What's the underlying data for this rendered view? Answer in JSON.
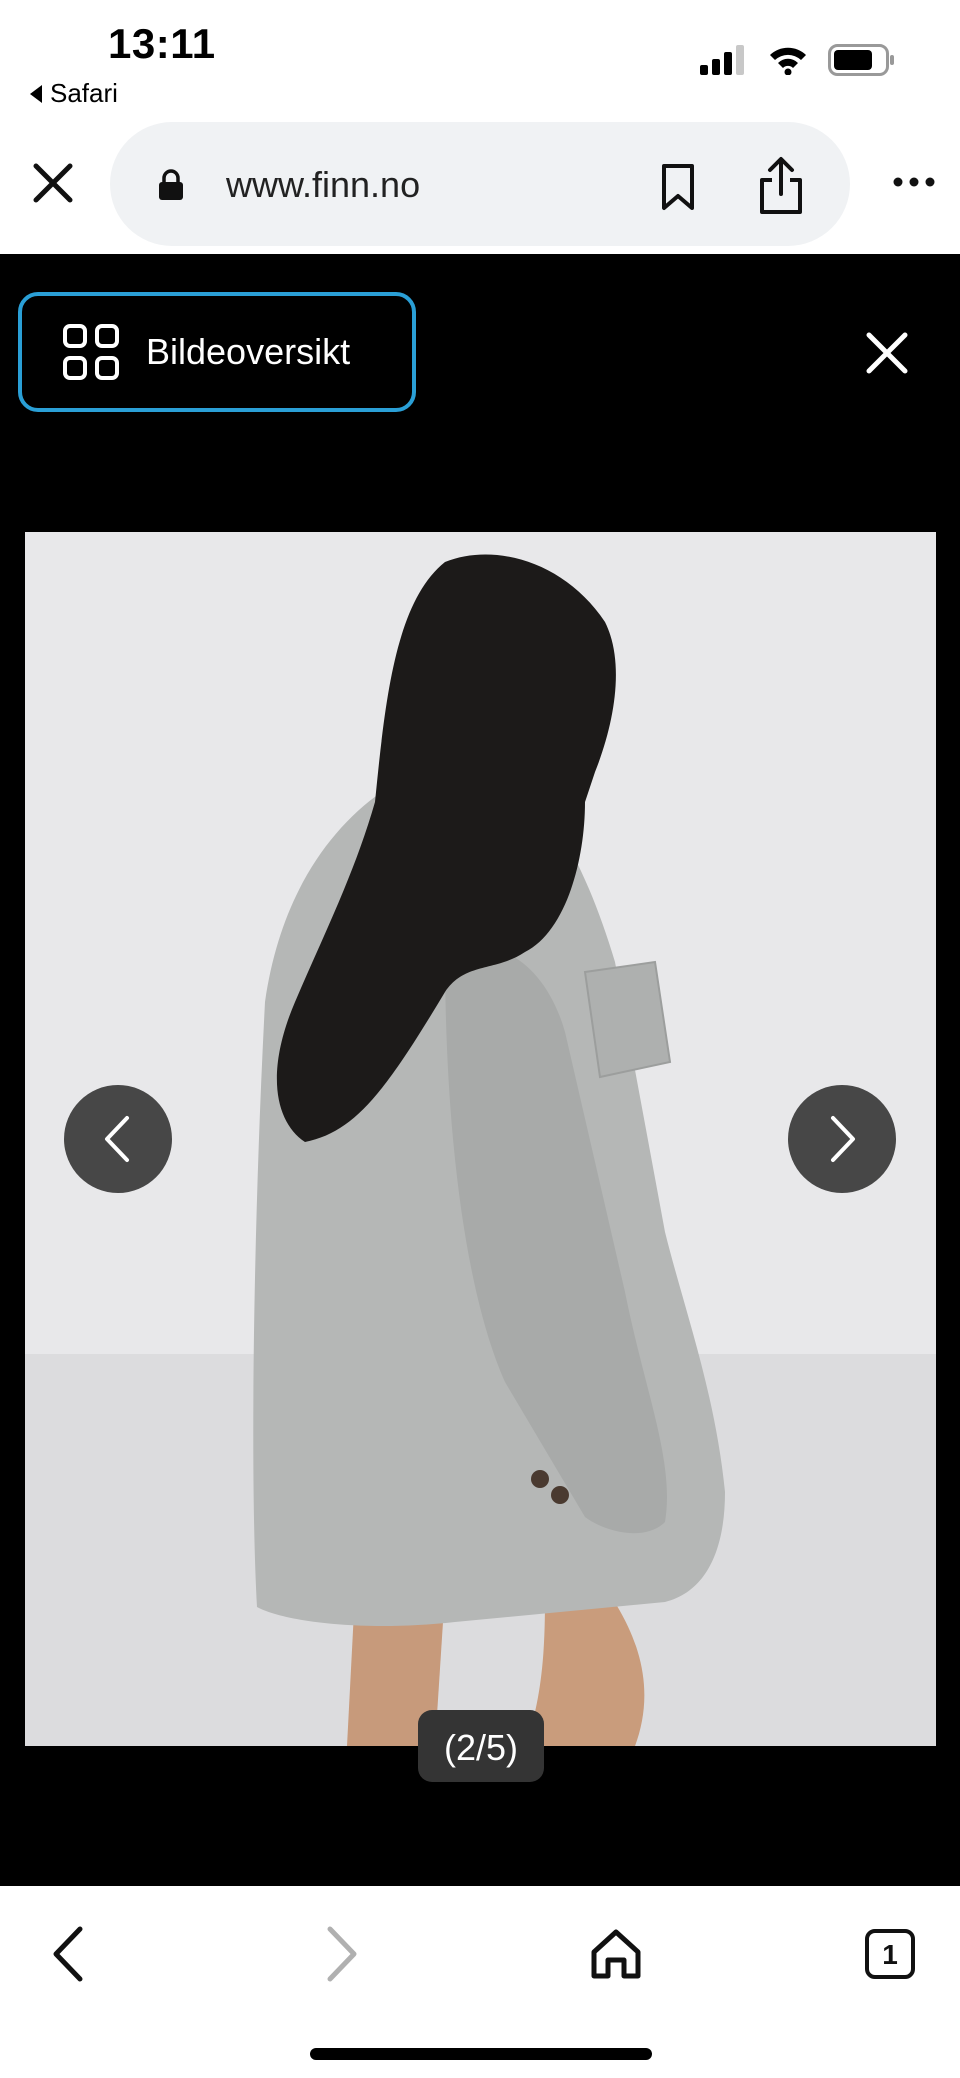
{
  "status": {
    "time": "13:11",
    "back_app": "Safari"
  },
  "browser": {
    "url": "www.finn.no"
  },
  "viewer": {
    "overview_label": "Bildeoversikt",
    "counter": "(2/5)"
  },
  "toolbar": {
    "tabs_count": "1"
  },
  "icons": {
    "status": [
      "signal-icon",
      "wifi-icon",
      "battery-icon"
    ],
    "browser": [
      "close-icon",
      "lock-icon",
      "bookmark-icon",
      "share-icon",
      "more-icon"
    ],
    "viewer": [
      "grid-icon",
      "close-icon",
      "chevron-left-icon",
      "chevron-right-icon"
    ],
    "toolbar": [
      "back-icon",
      "forward-icon",
      "home-icon",
      "tabs-icon"
    ]
  },
  "colors": {
    "accent": "#2a9fd6",
    "viewer_bg": "#000000",
    "coat": "#b4b6b5",
    "hair": "#1c1a19"
  }
}
